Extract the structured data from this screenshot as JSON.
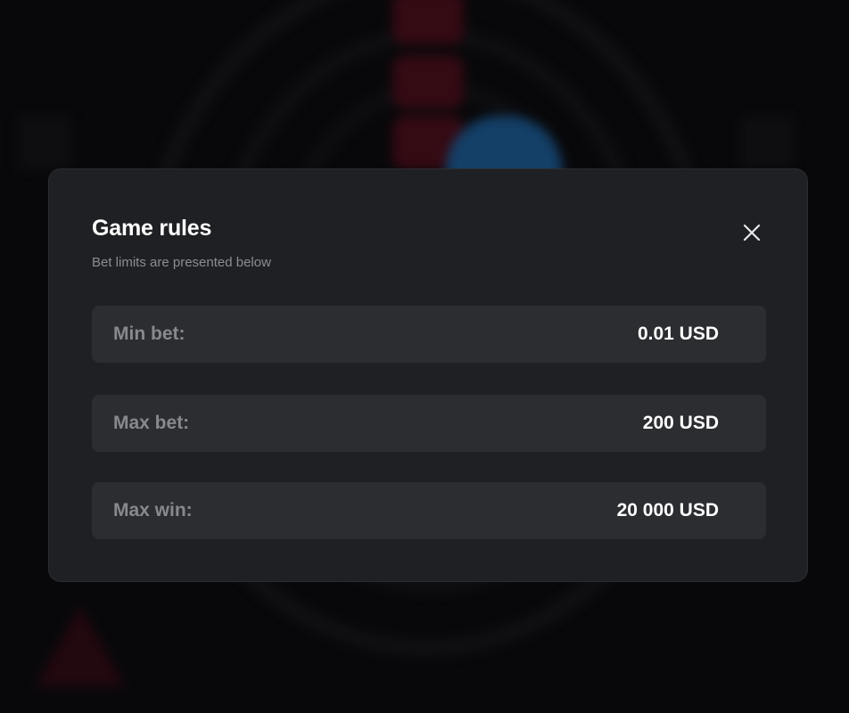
{
  "modal": {
    "title": "Game rules",
    "subtitle": "Bet limits are presented below",
    "close_icon": "close-icon",
    "limits": [
      {
        "label": "Min bet:",
        "value": "0.01 USD"
      },
      {
        "label": "Max bet:",
        "value": "200 USD"
      },
      {
        "label": "Max win:",
        "value": "20 000 USD"
      }
    ]
  },
  "colors": {
    "modal_background": "#1f2024",
    "row_background": "#2c2d31",
    "label_text": "#88898e",
    "value_text": "#ffffff",
    "backdrop": "#0a0a0c"
  }
}
